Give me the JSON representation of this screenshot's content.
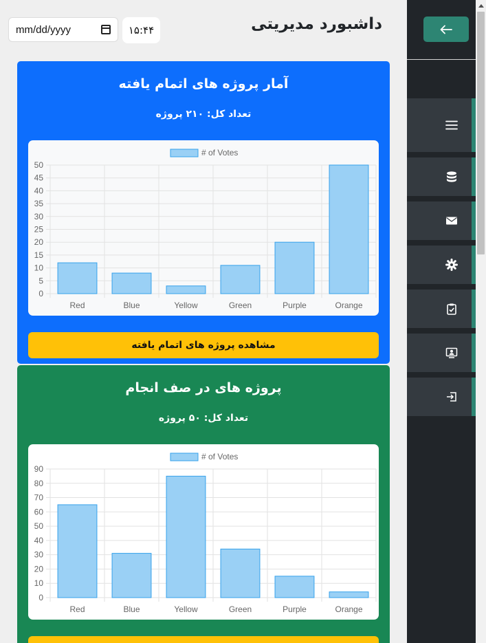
{
  "header": {
    "title": "داشبورد مدیریتی",
    "date_placeholder": "mm/dd/yyyy",
    "time": "۱۵:۴۴"
  },
  "cards": [
    {
      "title": "آمار پروژه های اتمام یافته",
      "subtitle": "تعداد کل: ۲۱۰ پروژه",
      "button_label": "مشاهده پروژه های اتمام یافته",
      "color": "#0d6efd"
    },
    {
      "title": "پروژه های در صف انجام",
      "subtitle": "تعداد کل: ۵۰ پروژه",
      "color": "#198754"
    }
  ],
  "sidebar": {
    "toggle_icon": "arrow-left-icon",
    "items": [
      {
        "icon": "menu-icon"
      },
      {
        "icon": "database-icon"
      },
      {
        "icon": "envelope-icon"
      },
      {
        "icon": "gear-icon"
      },
      {
        "icon": "clipboard-check-icon"
      },
      {
        "icon": "person-badge-icon"
      },
      {
        "icon": "logout-icon"
      }
    ],
    "accent": "#2d8573"
  },
  "chart_data": [
    {
      "type": "bar",
      "categories": [
        "Red",
        "Blue",
        "Yellow",
        "Green",
        "Purple",
        "Orange"
      ],
      "series": [
        {
          "name": "# of Votes",
          "values": [
            12,
            8,
            3,
            11,
            20,
            50
          ]
        }
      ],
      "ylim": [
        0,
        50
      ],
      "yticks": [
        0,
        5,
        10,
        15,
        20,
        25,
        30,
        35,
        40,
        45,
        50
      ],
      "grid": true,
      "legend": "top-center",
      "bar_color": "#9ad0f5",
      "bar_border": "#36a2eb"
    },
    {
      "type": "bar",
      "categories": [
        "Red",
        "Blue",
        "Yellow",
        "Green",
        "Purple",
        "Orange"
      ],
      "series": [
        {
          "name": "# of Votes",
          "values": [
            65,
            31,
            85,
            34,
            15,
            4
          ]
        }
      ],
      "ylim": [
        0,
        90
      ],
      "yticks": [
        0,
        10,
        20,
        30,
        40,
        50,
        60,
        70,
        80,
        90
      ],
      "grid": true,
      "legend": "top-center",
      "bar_color": "#9ad0f5",
      "bar_border": "#36a2eb"
    }
  ]
}
